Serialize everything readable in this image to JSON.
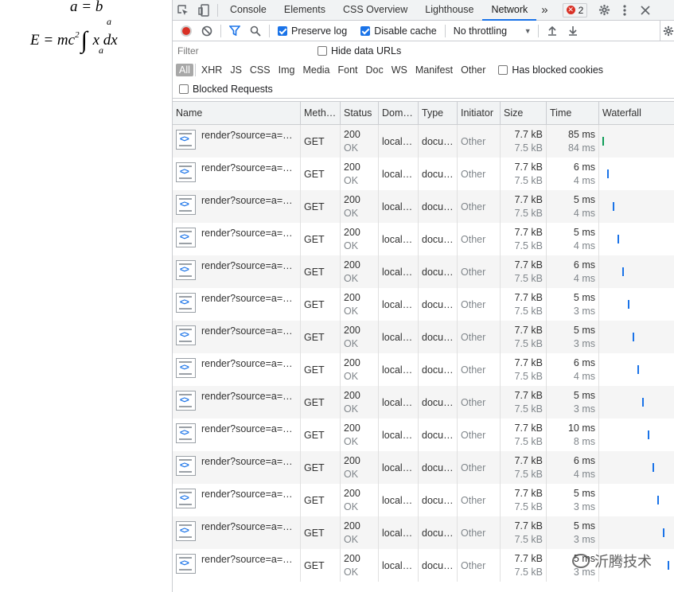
{
  "math": {
    "eq1": "a = b",
    "eq2_lhs": "E = mc",
    "eq2_exp": "2",
    "eq2_int": "∫",
    "eq2_upper": "a",
    "eq2_lower": "a",
    "eq2_body": "x dx"
  },
  "devtools": {
    "tabs": [
      {
        "label": "Console",
        "active": false
      },
      {
        "label": "Elements",
        "active": false
      },
      {
        "label": "CSS Overview",
        "active": false
      },
      {
        "label": "Lighthouse",
        "active": false
      },
      {
        "label": "Network",
        "active": true
      }
    ],
    "more_tabs": "»",
    "error_count": "2",
    "toolbar": {
      "preserve_log": "Preserve log",
      "disable_cache": "Disable cache",
      "throttling": "No throttling"
    },
    "filter": {
      "placeholder": "Filter",
      "hide_data_urls": "Hide data URLs"
    },
    "types": [
      {
        "label": "All",
        "active": true
      },
      {
        "label": "XHR",
        "active": false
      },
      {
        "label": "JS",
        "active": false
      },
      {
        "label": "CSS",
        "active": false
      },
      {
        "label": "Img",
        "active": false
      },
      {
        "label": "Media",
        "active": false
      },
      {
        "label": "Font",
        "active": false
      },
      {
        "label": "Doc",
        "active": false
      },
      {
        "label": "WS",
        "active": false
      },
      {
        "label": "Manifest",
        "active": false
      },
      {
        "label": "Other",
        "active": false
      }
    ],
    "has_blocked_cookies": "Has blocked cookies",
    "blocked_requests": "Blocked Requests",
    "columns": {
      "name": "Name",
      "method": "Meth…",
      "status": "Status",
      "domain": "Dom…",
      "type": "Type",
      "initiator": "Initiator",
      "size": "Size",
      "time": "Time",
      "waterfall": "Waterfall"
    },
    "rows": [
      {
        "name": "render?source=a=…",
        "method": "GET",
        "status": "200",
        "status_text": "OK",
        "domain": "local…",
        "type": "docu…",
        "initiator": "Other",
        "size": "7.7 kB",
        "resource": "7.5 kB",
        "time": "85 ms",
        "latency": "84 ms"
      },
      {
        "name": "render?source=a=…",
        "method": "GET",
        "status": "200",
        "status_text": "OK",
        "domain": "local…",
        "type": "docu…",
        "initiator": "Other",
        "size": "7.7 kB",
        "resource": "7.5 kB",
        "time": "6 ms",
        "latency": "4 ms"
      },
      {
        "name": "render?source=a=…",
        "method": "GET",
        "status": "200",
        "status_text": "OK",
        "domain": "local…",
        "type": "docu…",
        "initiator": "Other",
        "size": "7.7 kB",
        "resource": "7.5 kB",
        "time": "5 ms",
        "latency": "4 ms"
      },
      {
        "name": "render?source=a=…",
        "method": "GET",
        "status": "200",
        "status_text": "OK",
        "domain": "local…",
        "type": "docu…",
        "initiator": "Other",
        "size": "7.7 kB",
        "resource": "7.5 kB",
        "time": "5 ms",
        "latency": "4 ms"
      },
      {
        "name": "render?source=a=…",
        "method": "GET",
        "status": "200",
        "status_text": "OK",
        "domain": "local…",
        "type": "docu…",
        "initiator": "Other",
        "size": "7.7 kB",
        "resource": "7.5 kB",
        "time": "6 ms",
        "latency": "4 ms"
      },
      {
        "name": "render?source=a=…",
        "method": "GET",
        "status": "200",
        "status_text": "OK",
        "domain": "local…",
        "type": "docu…",
        "initiator": "Other",
        "size": "7.7 kB",
        "resource": "7.5 kB",
        "time": "5 ms",
        "latency": "3 ms"
      },
      {
        "name": "render?source=a=…",
        "method": "GET",
        "status": "200",
        "status_text": "OK",
        "domain": "local…",
        "type": "docu…",
        "initiator": "Other",
        "size": "7.7 kB",
        "resource": "7.5 kB",
        "time": "5 ms",
        "latency": "3 ms"
      },
      {
        "name": "render?source=a=…",
        "method": "GET",
        "status": "200",
        "status_text": "OK",
        "domain": "local…",
        "type": "docu…",
        "initiator": "Other",
        "size": "7.7 kB",
        "resource": "7.5 kB",
        "time": "6 ms",
        "latency": "4 ms"
      },
      {
        "name": "render?source=a=…",
        "method": "GET",
        "status": "200",
        "status_text": "OK",
        "domain": "local…",
        "type": "docu…",
        "initiator": "Other",
        "size": "7.7 kB",
        "resource": "7.5 kB",
        "time": "5 ms",
        "latency": "3 ms"
      },
      {
        "name": "render?source=a=…",
        "method": "GET",
        "status": "200",
        "status_text": "OK",
        "domain": "local…",
        "type": "docu…",
        "initiator": "Other",
        "size": "7.7 kB",
        "resource": "7.5 kB",
        "time": "10 ms",
        "latency": "8 ms"
      },
      {
        "name": "render?source=a=…",
        "method": "GET",
        "status": "200",
        "status_text": "OK",
        "domain": "local…",
        "type": "docu…",
        "initiator": "Other",
        "size": "7.7 kB",
        "resource": "7.5 kB",
        "time": "6 ms",
        "latency": "4 ms"
      },
      {
        "name": "render?source=a=…",
        "method": "GET",
        "status": "200",
        "status_text": "OK",
        "domain": "local…",
        "type": "docu…",
        "initiator": "Other",
        "size": "7.7 kB",
        "resource": "7.5 kB",
        "time": "5 ms",
        "latency": "3 ms"
      },
      {
        "name": "render?source=a=…",
        "method": "GET",
        "status": "200",
        "status_text": "OK",
        "domain": "local…",
        "type": "docu…",
        "initiator": "Other",
        "size": "7.7 kB",
        "resource": "7.5 kB",
        "time": "5 ms",
        "latency": "3 ms"
      },
      {
        "name": "render?source=a=…",
        "method": "GET",
        "status": "200",
        "status_text": "OK",
        "domain": "local…",
        "type": "docu…",
        "initiator": "Other",
        "size": "7.7 kB",
        "resource": "7.5 kB",
        "time": "5 ms",
        "latency": "3 ms"
      }
    ]
  },
  "watermark": "沂腾技术",
  "colors": {
    "accent": "#1a73e8",
    "record": "#d93025",
    "waterfall_first": "#0f9d58"
  }
}
